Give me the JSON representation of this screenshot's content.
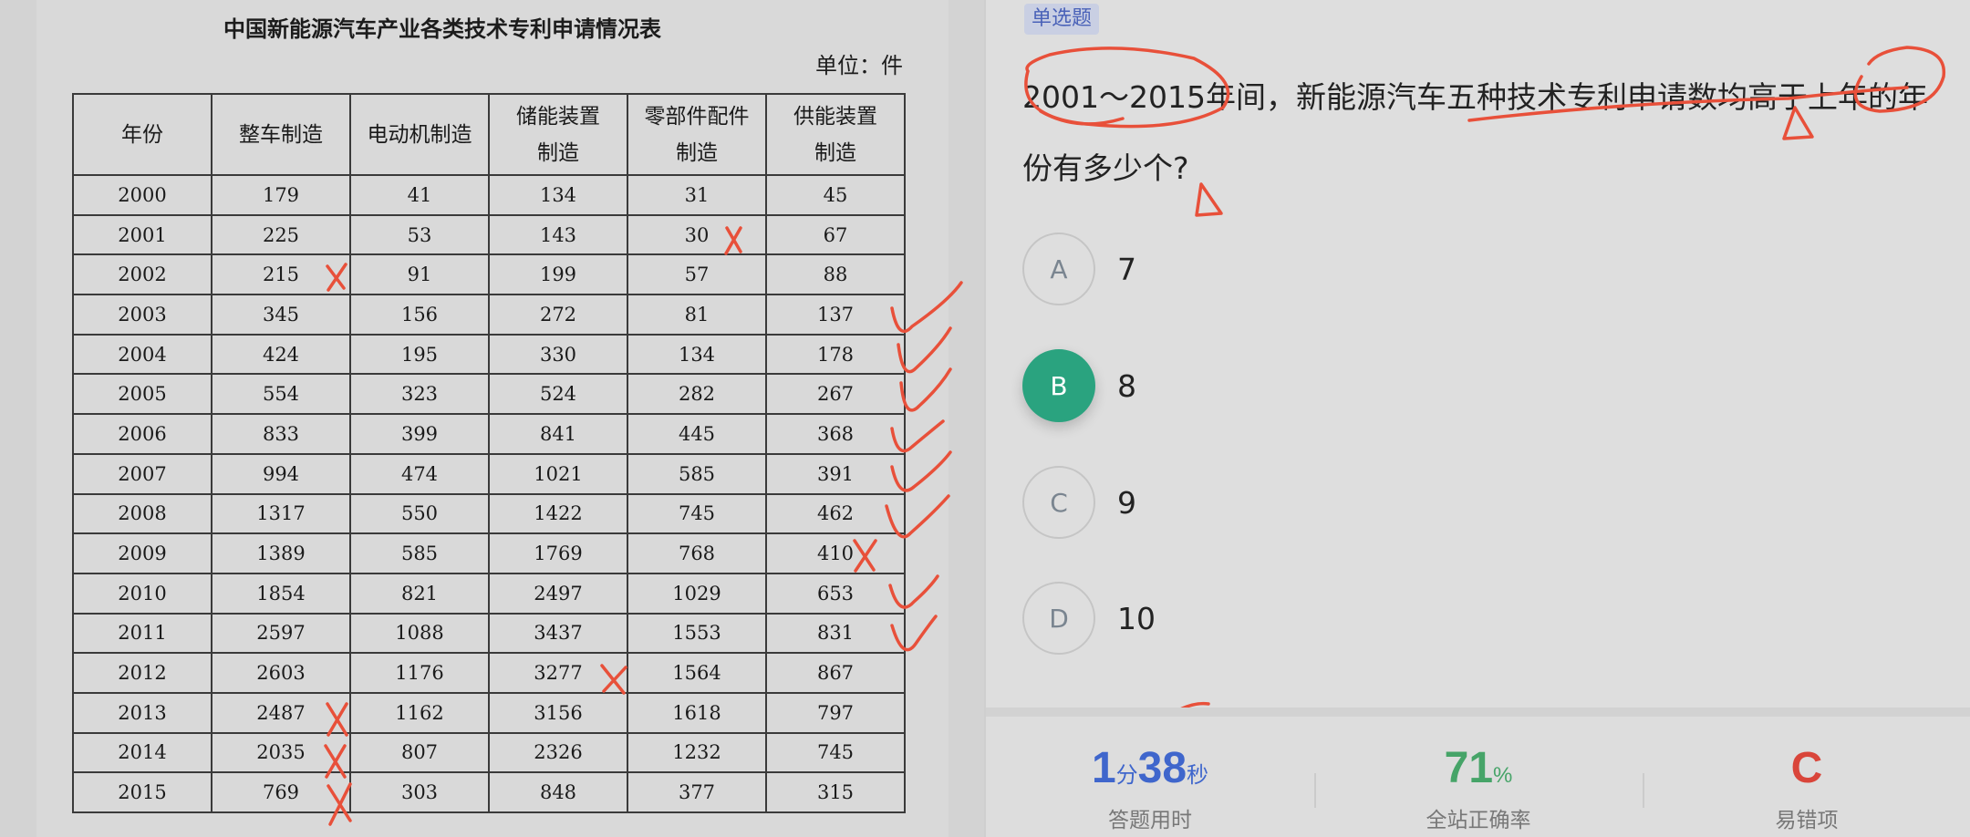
{
  "table": {
    "title": "中国新能源汽车产业各类技术专利申请情况表",
    "unit": "单位：件",
    "headers": [
      {
        "line1": "年份",
        "line2": ""
      },
      {
        "line1": "整车制造",
        "line2": ""
      },
      {
        "line1": "电动机制造",
        "line2": ""
      },
      {
        "line1": "储能装置",
        "line2": "制造"
      },
      {
        "line1": "零部件配件",
        "line2": "制造"
      },
      {
        "line1": "供能装置",
        "line2": "制造"
      }
    ],
    "rows": [
      [
        "2000",
        "179",
        "41",
        "134",
        "31",
        "45"
      ],
      [
        "2001",
        "225",
        "53",
        "143",
        "30",
        "67"
      ],
      [
        "2002",
        "215",
        "91",
        "199",
        "57",
        "88"
      ],
      [
        "2003",
        "345",
        "156",
        "272",
        "81",
        "137"
      ],
      [
        "2004",
        "424",
        "195",
        "330",
        "134",
        "178"
      ],
      [
        "2005",
        "554",
        "323",
        "524",
        "282",
        "267"
      ],
      [
        "2006",
        "833",
        "399",
        "841",
        "445",
        "368"
      ],
      [
        "2007",
        "994",
        "474",
        "1021",
        "585",
        "391"
      ],
      [
        "2008",
        "1317",
        "550",
        "1422",
        "745",
        "462"
      ],
      [
        "2009",
        "1389",
        "585",
        "1769",
        "768",
        "410"
      ],
      [
        "2010",
        "1854",
        "821",
        "2497",
        "1029",
        "653"
      ],
      [
        "2011",
        "2597",
        "1088",
        "3437",
        "1553",
        "831"
      ],
      [
        "2012",
        "2603",
        "1176",
        "3277",
        "1564",
        "867"
      ],
      [
        "2013",
        "2487",
        "1162",
        "3156",
        "1618",
        "797"
      ],
      [
        "2014",
        "2035",
        "807",
        "2326",
        "1232",
        "745"
      ],
      [
        "2015",
        "769",
        "303",
        "848",
        "377",
        "315"
      ]
    ]
  },
  "question": {
    "type_badge": "单选题",
    "text": "2001～2015年间，新能源汽车五种技术专利申请数均高于上年的年份有多少个?"
  },
  "options": [
    {
      "letter": "A",
      "value": "7",
      "selected": false
    },
    {
      "letter": "B",
      "value": "8",
      "selected": true
    },
    {
      "letter": "C",
      "value": "9",
      "selected": false
    },
    {
      "letter": "D",
      "value": "10",
      "selected": false
    }
  ],
  "stats": {
    "time_min": "1",
    "time_min_unit": "分",
    "time_sec": "38",
    "time_sec_unit": "秒",
    "time_label": "答题用时",
    "accuracy": "71",
    "accuracy_unit": "%",
    "accuracy_label": "全站正确率",
    "error_option": "C",
    "error_label": "易错项"
  },
  "colors": {
    "selected_option": "#2aa37f",
    "annotation_ink": "#e8503a",
    "time_blue": "#3f66cc",
    "accuracy_green": "#46a468",
    "error_red": "#d9453a"
  }
}
